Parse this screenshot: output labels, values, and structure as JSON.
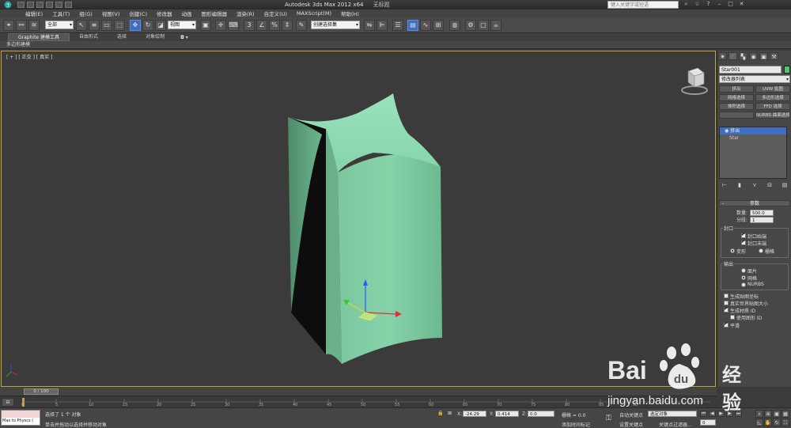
{
  "title": {
    "app_name": "Autodesk 3ds Max  2012 x64",
    "file_name": "无标题",
    "search_placeholder": "键入关键字或短语"
  },
  "menu": [
    "编辑(E)",
    "工具(T)",
    "组(G)",
    "视图(V)",
    "创建(C)",
    "修改器",
    "动画",
    "图形编辑器",
    "渲染(R)",
    "自定义(U)",
    "MAXScript(M)",
    "帮助(H)"
  ],
  "toolbar": {
    "selection_filter": "全部",
    "ref_coord": "视图",
    "named_selection": "创建选择集"
  },
  "ribbon": {
    "tabs": [
      "Graphite 建模工具",
      "自由形式",
      "选择",
      "对象绘制"
    ],
    "sub_label": "多边形建模"
  },
  "viewport": {
    "label": "[ + ] [ 正交 ] [ 真实 ]",
    "object_color": "#8fd9b0",
    "border_color": "#c8a23a"
  },
  "command_panel": {
    "tab_icons": [
      "create-icon",
      "modify-icon",
      "hierarchy-icon",
      "motion-icon",
      "display-icon",
      "utilities-icon"
    ],
    "object_name": "Star001",
    "object_color": "#52c46e",
    "modifier_list": "修改器列表",
    "modifier_buttons": [
      "挤出",
      "UVW 贴图",
      "网格选择",
      "多边形选择",
      "体积选择",
      "FFD 选择",
      "",
      "NURBS 曲面选择"
    ],
    "stack": [
      "挤出",
      "Star"
    ],
    "params_title": "参数",
    "amount_label": "数量:",
    "amount_value": "500.0",
    "segments_label": "分段:",
    "segments_value": "1",
    "capping_title": "封口",
    "cap_start": "封口始端",
    "cap_end": "封口末端",
    "morph": "变形",
    "grid": "栅格",
    "output_title": "输出",
    "patch": "面片",
    "mesh": "网格",
    "nurbs": "NURBS",
    "gen_mapping": "生成贴图坐标",
    "real_world": "真实世界贴图大小",
    "gen_mat_ids": "生成材质 ID",
    "use_shape_ids": "使用图形 ID",
    "smooth": "平滑"
  },
  "timeline": {
    "frame_display": "0 / 100",
    "ticks": [
      "0",
      "5",
      "10",
      "15",
      "20",
      "25",
      "30",
      "35",
      "40",
      "45",
      "50",
      "55",
      "60",
      "65",
      "70",
      "75",
      "80",
      "85",
      "90"
    ]
  },
  "status": {
    "maxscript_label": "Max to Physcs (",
    "line1": "选择了 1 个 对象",
    "line2": "单击并拖动以选择并移动对象",
    "x_label": "X:",
    "x_value": "-24.29",
    "y_label": "Y:",
    "y_value": "0.414",
    "z_label": "Z:",
    "z_value": "0.0",
    "grid_text": "栅格 = 0.0",
    "auto_key": "自动关键点",
    "selected_dd": "选定对象",
    "set_key": "设置关键点",
    "key_filters": "关键点过滤器...",
    "add_time_tag": "添加时间标记",
    "frame_value": "0"
  },
  "watermark": {
    "bai": "Bai",
    "jingyan": "经验",
    "url": "jingyan.baidu.com"
  }
}
